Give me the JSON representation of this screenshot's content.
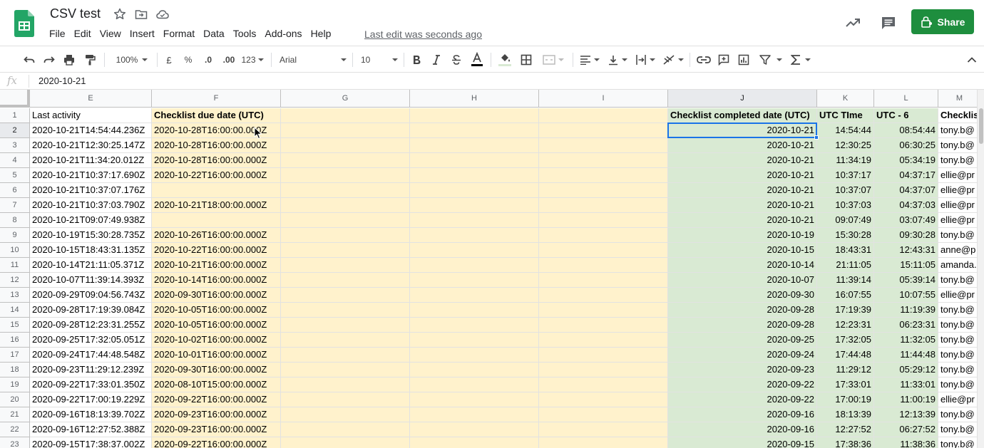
{
  "header": {
    "doc_title": "CSV test",
    "menus": [
      "File",
      "Edit",
      "View",
      "Insert",
      "Format",
      "Data",
      "Tools",
      "Add-ons",
      "Help"
    ],
    "last_edit": "Last edit was seconds ago",
    "share_label": "Share",
    "icons": [
      "sheets-logo-icon",
      "star-icon",
      "move-folder-icon",
      "cloud-saved-icon",
      "explore-trend-icon",
      "comment-icon",
      "lock-people-icon"
    ]
  },
  "toolbar": {
    "zoom": "100%",
    "currency": "£",
    "percent": "%",
    "decrease_decimal": ".0",
    "increase_decimal": ".00",
    "more_formats": "123",
    "font_family": "Arial",
    "font_size": "10",
    "text_color": "#000000",
    "icons": [
      "undo-icon",
      "redo-icon",
      "print-icon",
      "paint-format-icon",
      "bold-icon",
      "italic-icon",
      "strikethrough-icon",
      "text-color-icon",
      "fill-color-icon",
      "borders-icon",
      "merge-cells-icon",
      "align-horizontal-icon",
      "align-vertical-icon",
      "text-wrap-icon",
      "text-rotate-icon",
      "insert-link-icon",
      "insert-comment-icon",
      "insert-chart-icon",
      "filter-icon",
      "functions-icon",
      "collapse-toolbar-icon"
    ]
  },
  "formula_bar": {
    "fx_label": "fx",
    "value": "2020-10-21"
  },
  "colors": {
    "yellow_fill": "#fff2cc",
    "green_fill": "#d9ead3",
    "selection": "#1a73e8",
    "share_green": "#1e8e3e"
  },
  "grid": {
    "selected_cell": "J2",
    "columns": [
      {
        "id": "E",
        "header": "Last activity"
      },
      {
        "id": "F",
        "header": "Checklist due date (UTC)"
      },
      {
        "id": "G",
        "header": ""
      },
      {
        "id": "H",
        "header": ""
      },
      {
        "id": "I",
        "header": ""
      },
      {
        "id": "J",
        "header": "Checklist completed date (UTC)"
      },
      {
        "id": "K",
        "header": "UTC TIme"
      },
      {
        "id": "L",
        "header": "UTC - 6"
      },
      {
        "id": "M",
        "header": "Checklis"
      }
    ],
    "row_numbers": [
      "1",
      "2",
      "3",
      "4",
      "5",
      "6",
      "7",
      "8",
      "9",
      "10",
      "11",
      "12",
      "13",
      "14",
      "15",
      "16",
      "17",
      "18",
      "19",
      "20",
      "21",
      "22",
      "23"
    ],
    "rows": [
      [
        "2020-10-21T14:54:44.236Z",
        "2020-10-28T16:00:00.000Z",
        "",
        "",
        "",
        "2020-10-21",
        "14:54:44",
        "08:54:44",
        "tony.b@"
      ],
      [
        "2020-10-21T12:30:25.147Z",
        "2020-10-28T16:00:00.000Z",
        "",
        "",
        "",
        "2020-10-21",
        "12:30:25",
        "06:30:25",
        "tony.b@"
      ],
      [
        "2020-10-21T11:34:20.012Z",
        "2020-10-28T16:00:00.000Z",
        "",
        "",
        "",
        "2020-10-21",
        "11:34:19",
        "05:34:19",
        "tony.b@"
      ],
      [
        "2020-10-21T10:37:17.690Z",
        "2020-10-22T16:00:00.000Z",
        "",
        "",
        "",
        "2020-10-21",
        "10:37:17",
        "04:37:17",
        "ellie@pr"
      ],
      [
        "2020-10-21T10:37:07.176Z",
        "",
        "",
        "",
        "",
        "2020-10-21",
        "10:37:07",
        "04:37:07",
        "ellie@pr"
      ],
      [
        "2020-10-21T10:37:03.790Z",
        "2020-10-21T18:00:00.000Z",
        "",
        "",
        "",
        "2020-10-21",
        "10:37:03",
        "04:37:03",
        "ellie@pr"
      ],
      [
        "2020-10-21T09:07:49.938Z",
        "",
        "",
        "",
        "",
        "2020-10-21",
        "09:07:49",
        "03:07:49",
        "ellie@pr"
      ],
      [
        "2020-10-19T15:30:28.735Z",
        "2020-10-26T16:00:00.000Z",
        "",
        "",
        "",
        "2020-10-19",
        "15:30:28",
        "09:30:28",
        "tony.b@"
      ],
      [
        "2020-10-15T18:43:31.135Z",
        "2020-10-22T16:00:00.000Z",
        "",
        "",
        "",
        "2020-10-15",
        "18:43:31",
        "12:43:31",
        "anne@p"
      ],
      [
        "2020-10-14T21:11:05.371Z",
        "2020-10-21T16:00:00.000Z",
        "",
        "",
        "",
        "2020-10-14",
        "21:11:05",
        "15:11:05",
        "amanda."
      ],
      [
        "2020-10-07T11:39:14.393Z",
        "2020-10-14T16:00:00.000Z",
        "",
        "",
        "",
        "2020-10-07",
        "11:39:14",
        "05:39:14",
        "tony.b@"
      ],
      [
        "2020-09-29T09:04:56.743Z",
        "2020-09-30T16:00:00.000Z",
        "",
        "",
        "",
        "2020-09-30",
        "16:07:55",
        "10:07:55",
        "ellie@pr"
      ],
      [
        "2020-09-28T17:19:39.084Z",
        "2020-10-05T16:00:00.000Z",
        "",
        "",
        "",
        "2020-09-28",
        "17:19:39",
        "11:19:39",
        "tony.b@"
      ],
      [
        "2020-09-28T12:23:31.255Z",
        "2020-10-05T16:00:00.000Z",
        "",
        "",
        "",
        "2020-09-28",
        "12:23:31",
        "06:23:31",
        "tony.b@"
      ],
      [
        "2020-09-25T17:32:05.051Z",
        "2020-10-02T16:00:00.000Z",
        "",
        "",
        "",
        "2020-09-25",
        "17:32:05",
        "11:32:05",
        "tony.b@"
      ],
      [
        "2020-09-24T17:44:48.548Z",
        "2020-10-01T16:00:00.000Z",
        "",
        "",
        "",
        "2020-09-24",
        "17:44:48",
        "11:44:48",
        "tony.b@"
      ],
      [
        "2020-09-23T11:29:12.239Z",
        "2020-09-30T16:00:00.000Z",
        "",
        "",
        "",
        "2020-09-23",
        "11:29:12",
        "05:29:12",
        "tony.b@"
      ],
      [
        "2020-09-22T17:33:01.350Z",
        "2020-08-10T15:00:00.000Z",
        "",
        "",
        "",
        "2020-09-22",
        "17:33:01",
        "11:33:01",
        "tony.b@"
      ],
      [
        "2020-09-22T17:00:19.229Z",
        "2020-09-22T16:00:00.000Z",
        "",
        "",
        "",
        "2020-09-22",
        "17:00:19",
        "11:00:19",
        "ellie@pr"
      ],
      [
        "2020-09-16T18:13:39.702Z",
        "2020-09-23T16:00:00.000Z",
        "",
        "",
        "",
        "2020-09-16",
        "18:13:39",
        "12:13:39",
        "tony.b@"
      ],
      [
        "2020-09-16T12:27:52.388Z",
        "2020-09-23T16:00:00.000Z",
        "",
        "",
        "",
        "2020-09-16",
        "12:27:52",
        "06:27:52",
        "tony.b@"
      ],
      [
        "2020-09-15T17:38:37.002Z",
        "2020-09-22T16:00:00.000Z",
        "",
        "",
        "",
        "2020-09-15",
        "17:38:36",
        "11:38:36",
        "tony.b@"
      ]
    ]
  }
}
